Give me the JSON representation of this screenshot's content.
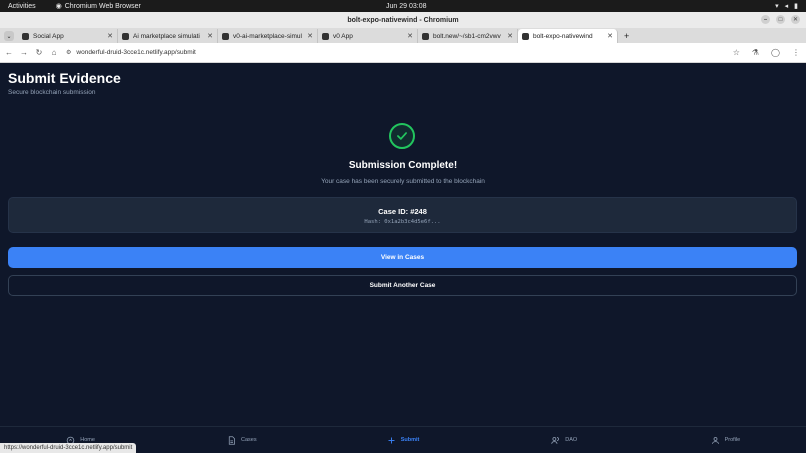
{
  "system": {
    "activities": "Activities",
    "app_name": "Chromium Web Browser",
    "clock": "Jun 29  03:08"
  },
  "window": {
    "title": "bolt-expo-nativewind - Chromium"
  },
  "tabs": [
    {
      "label": "Social App"
    },
    {
      "label": "Ai marketplace simulati"
    },
    {
      "label": "v0-ai-marketplace-simul"
    },
    {
      "label": "v0 App"
    },
    {
      "label": "bolt.new/~/sb1-cm2vwv"
    },
    {
      "label": "bolt-expo-nativewind"
    }
  ],
  "address": {
    "url": "wonderful-druid-3cce1c.netlify.app/submit"
  },
  "page": {
    "title": "Submit Evidence",
    "subtitle": "Secure blockchain submission",
    "done_title": "Submission Complete!",
    "done_subtitle": "Your case has been securely submitted to the blockchain",
    "case_id": "Case ID: #248",
    "hash": "Hash: 0x1a2b3c4d5e6f...",
    "primary_button": "View in Cases",
    "secondary_button": "Submit Another Case",
    "success_color": "#22c55e",
    "accent_color": "#3b82f6"
  },
  "bottom_nav": [
    {
      "label": "Home",
      "icon": "home-icon"
    },
    {
      "label": "Cases",
      "icon": "file-icon"
    },
    {
      "label": "Submit",
      "icon": "plus-icon",
      "active": true
    },
    {
      "label": "DAO",
      "icon": "users-icon"
    },
    {
      "label": "Profile",
      "icon": "user-icon"
    }
  ],
  "status_url": "https://wonderful-druid-3cce1c.netlify.app/submit"
}
